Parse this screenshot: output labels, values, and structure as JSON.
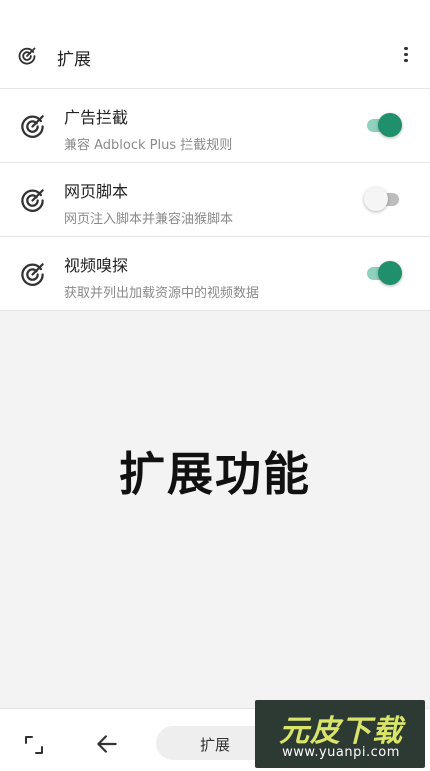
{
  "app_bar": {
    "icon": "target-check-icon",
    "title": "扩展",
    "more_icon": "more-vert-icon"
  },
  "extensions": [
    {
      "icon": "target-check-icon",
      "title": "广告拦截",
      "subtitle": "兼容 Adblock Plus 拦截规则",
      "enabled": true
    },
    {
      "icon": "target-check-icon",
      "title": "网页脚本",
      "subtitle": "网页注入脚本并兼容油猴脚本",
      "enabled": false
    },
    {
      "icon": "target-check-icon",
      "title": "视频嗅探",
      "subtitle": "获取并列出加载资源中的视频数据",
      "enabled": true
    }
  ],
  "main": {
    "feature_title": "扩展功能"
  },
  "bottom_bar": {
    "tabs_icon": "tabs-corner-icon",
    "back_icon": "arrow-left-icon",
    "url_text": "扩展"
  },
  "watermark": {
    "name": "元皮下载",
    "url": "www.yuanpi.com"
  },
  "colors": {
    "accent": "#1f8f6c",
    "accent_track": "#8fd0be",
    "background": "#f3f3f3"
  }
}
